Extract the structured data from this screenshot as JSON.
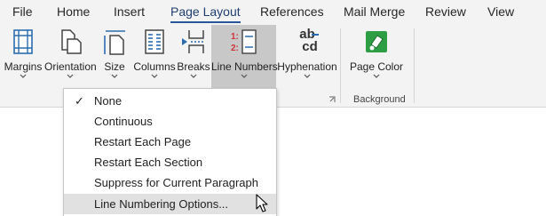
{
  "tabs": [
    {
      "label": "File"
    },
    {
      "label": "Home"
    },
    {
      "label": "Insert"
    },
    {
      "label": "Page Layout"
    },
    {
      "label": "References"
    },
    {
      "label": "Mail Merge"
    },
    {
      "label": "Review"
    },
    {
      "label": "View"
    }
  ],
  "active_tab": "Page Layout",
  "ribbon": {
    "buttons": [
      {
        "label": "Margins",
        "icon": "margins-icon"
      },
      {
        "label": "Orientation",
        "icon": "orientation-icon"
      },
      {
        "label": "Size",
        "icon": "size-icon"
      },
      {
        "label": "Columns",
        "icon": "columns-icon"
      },
      {
        "label": "Breaks",
        "icon": "breaks-icon"
      },
      {
        "label": "Line Numbers",
        "icon": "line-numbers-icon"
      },
      {
        "label": "Hyphenation",
        "icon": "hyphenation-icon"
      },
      {
        "label": "Page Color",
        "icon": "page-color-icon"
      }
    ],
    "groups": [
      {
        "label": "Background"
      }
    ],
    "hyphenation_glyph_top": "ab",
    "hyphenation_glyph_bottom": "cd",
    "line_numbers_glyph": [
      "1:",
      "2:"
    ]
  },
  "menu": {
    "items": [
      {
        "label": "None",
        "checked": true
      },
      {
        "label": "Continuous",
        "checked": false
      },
      {
        "label": "Restart Each Page",
        "checked": false
      },
      {
        "label": "Restart Each Section",
        "checked": false
      },
      {
        "label": "Suppress for Current Paragraph",
        "checked": false
      },
      {
        "label": "Line Numbering Options...",
        "checked": false,
        "hover": true
      }
    ],
    "check_glyph": "✓"
  },
  "colors": {
    "accent": "#2b579a",
    "highlight": "#c8c8c8",
    "menu_hover": "#e1e1e1",
    "icon_blue": "#2b6cb0",
    "icon_red": "#d13438",
    "page_color_green": "#2e9e44"
  }
}
